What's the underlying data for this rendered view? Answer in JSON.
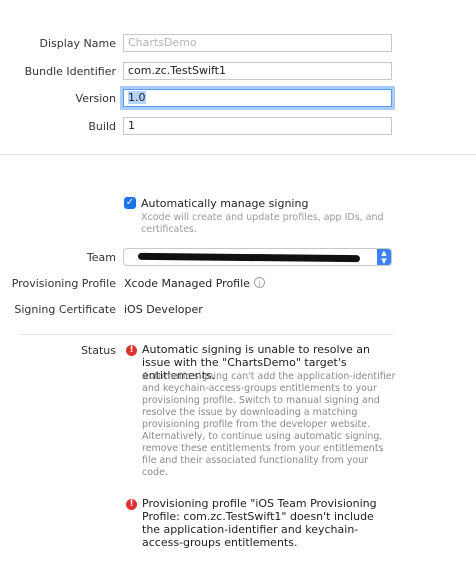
{
  "general": {
    "display_name_label": "Display Name",
    "display_name_placeholder": "ChartsDemo",
    "bundle_identifier_label": "Bundle Identifier",
    "bundle_identifier_value": "com.zc.TestSwift1",
    "version_label": "Version",
    "version_value": "1.0",
    "build_label": "Build",
    "build_value": "1"
  },
  "signing": {
    "auto_manage_label": "Automatically manage signing",
    "auto_manage_checked": true,
    "auto_manage_desc": "Xcode will create and update profiles, app IDs, and certificates.",
    "team_label": "Team",
    "provisioning_profile_label": "Provisioning Profile",
    "provisioning_profile_value": "Xcode Managed Profile",
    "signing_certificate_label": "Signing Certificate",
    "signing_certificate_value": "iOS Developer",
    "status_label": "Status",
    "errors": [
      {
        "title": "Automatic signing is unable to resolve an issue with the \"ChartsDemo\" target's entitlements.",
        "body": "Automatic signing can't add the application-identifier and keychain-access-groups entitlements to your provisioning profile. Switch to manual signing and resolve the issue by downloading a matching provisioning profile from the developer website. Alternatively, to continue using automatic signing, remove these entitlements from your entitlements file and their associated functionality from your code."
      },
      {
        "title": "Provisioning profile \"iOS Team Provisioning Profile: com.zc.TestSwift1\" doesn't include the application-identifier and keychain-access-groups entitlements.",
        "body": ""
      }
    ]
  },
  "icons": {
    "checkbox": "checkmark-icon",
    "info": "info-icon",
    "error": "error-icon",
    "stepper": "chevron-updown-icon"
  },
  "colors": {
    "accent": "#1a73e8",
    "error": "#e03131",
    "focus_ring": "#a9cdf8"
  }
}
